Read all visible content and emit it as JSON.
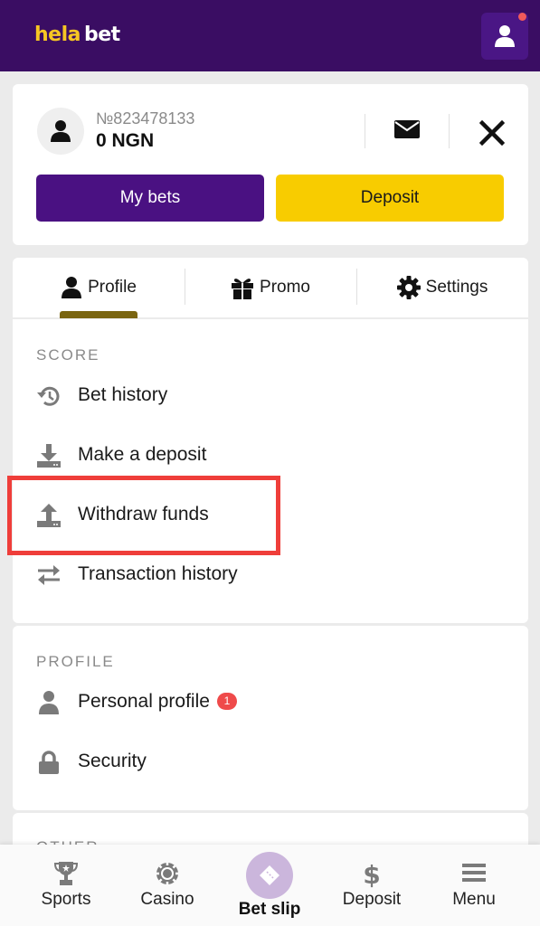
{
  "header": {
    "logo_part1": "hela",
    "logo_part2": "bet",
    "account_icon": "user-icon",
    "has_notification": true
  },
  "user_card": {
    "account_number": "№823478133",
    "balance": "0 NGN",
    "mail_icon": "envelope-icon",
    "close_icon": "close-icon",
    "my_bets_label": "My bets",
    "deposit_label": "Deposit"
  },
  "tabs": [
    {
      "label": "Profile",
      "icon": "user-icon",
      "active": true
    },
    {
      "label": "Promo",
      "icon": "gift-icon",
      "active": false
    },
    {
      "label": "Settings",
      "icon": "gear-icon",
      "active": false
    }
  ],
  "sections": {
    "score": {
      "title": "SCORE",
      "items": [
        {
          "label": "Bet history",
          "icon": "history-icon"
        },
        {
          "label": "Make a deposit",
          "icon": "download-icon"
        },
        {
          "label": "Withdraw funds",
          "icon": "upload-icon",
          "highlighted": true
        },
        {
          "label": "Transaction history",
          "icon": "transfer-arrows-icon"
        }
      ]
    },
    "profile": {
      "title": "PROFILE",
      "items": [
        {
          "label": "Personal profile",
          "icon": "user-icon",
          "badge": "1"
        },
        {
          "label": "Security",
          "icon": "lock-icon"
        }
      ]
    },
    "other": {
      "title": "OTHER"
    }
  },
  "bottom_nav": [
    {
      "label": "Sports",
      "icon": "trophy-icon"
    },
    {
      "label": "Casino",
      "icon": "casino-chip-icon"
    },
    {
      "label": "Bet slip",
      "icon": "ticket-icon",
      "emphasized": true
    },
    {
      "label": "Deposit",
      "icon": "dollar-icon"
    },
    {
      "label": "Menu",
      "icon": "hamburger-menu-icon"
    }
  ],
  "colors": {
    "brand_purple": "#3a0d63",
    "button_purple": "#4a1182",
    "brand_yellow": "#f8cc00",
    "badge_red": "#ef4a4a",
    "highlight_red": "#ef3e3a",
    "tab_indicator": "#7a6510"
  }
}
